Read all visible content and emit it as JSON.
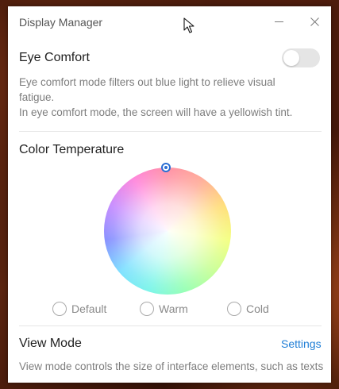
{
  "window": {
    "title": "Display Manager"
  },
  "eye_comfort": {
    "title": "Eye Comfort",
    "enabled": false,
    "description_line1": "Eye comfort mode filters out blue light to relieve visual",
    "description_line2": "fatigue.",
    "description_line3": "In eye comfort mode, the screen will have a yellowish tint."
  },
  "color_temperature": {
    "title": "Color Temperature",
    "options": [
      {
        "label": "Default",
        "selected": false
      },
      {
        "label": "Warm",
        "selected": false
      },
      {
        "label": "Cold",
        "selected": false
      }
    ]
  },
  "view_mode": {
    "title": "View Mode",
    "settings_link": "Settings",
    "description": "View mode controls the size of interface elements, such as texts"
  },
  "icons": {
    "minimize": "minimize-icon",
    "close": "close-icon",
    "cursor": "mouse-pointer-icon",
    "wheel_handle": "color-picker-handle-icon"
  },
  "colors": {
    "accent": "#1f7ed6",
    "toggle_off": "#e5e5e5",
    "text_primary": "#1f1f1f",
    "text_secondary": "#7d7d7d"
  }
}
